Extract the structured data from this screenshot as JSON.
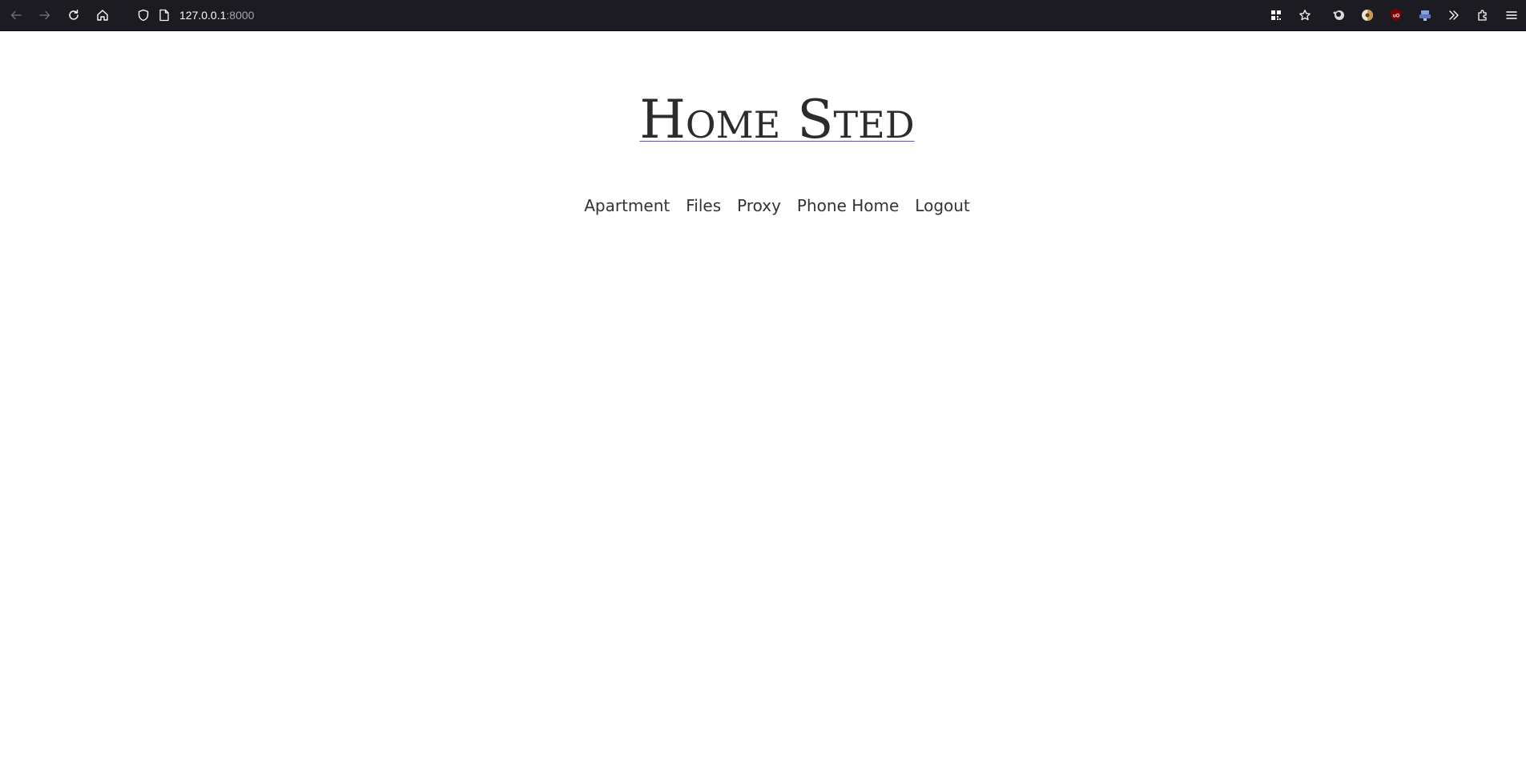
{
  "browser": {
    "url_host": "127.0.0.1",
    "url_port": ":8000",
    "icons": {
      "back": "arrow-left-icon",
      "forward": "arrow-right-icon",
      "reload": "reload-icon",
      "home": "home-icon",
      "tracking": "shield-icon",
      "page": "page-icon",
      "qr": "qr-code-icon",
      "bookmark": "star-icon",
      "ext1": "extension-icon",
      "ext2": "extension-icon",
      "ublock": "ublock-icon",
      "ext4": "extension-icon",
      "overflow": "chevron-double-right-icon",
      "extensions": "puzzle-icon",
      "menu": "hamburger-menu-icon"
    }
  },
  "site": {
    "title": "Home Sted",
    "nav": [
      {
        "label": "Apartment"
      },
      {
        "label": "Files"
      },
      {
        "label": "Proxy"
      },
      {
        "label": "Phone Home"
      },
      {
        "label": "Logout"
      }
    ]
  },
  "colors": {
    "toolbar_bg": "#1c1b22",
    "title_color": "#2c2c2c",
    "title_underline": "#5a4fcf",
    "nav_text": "#333333"
  }
}
